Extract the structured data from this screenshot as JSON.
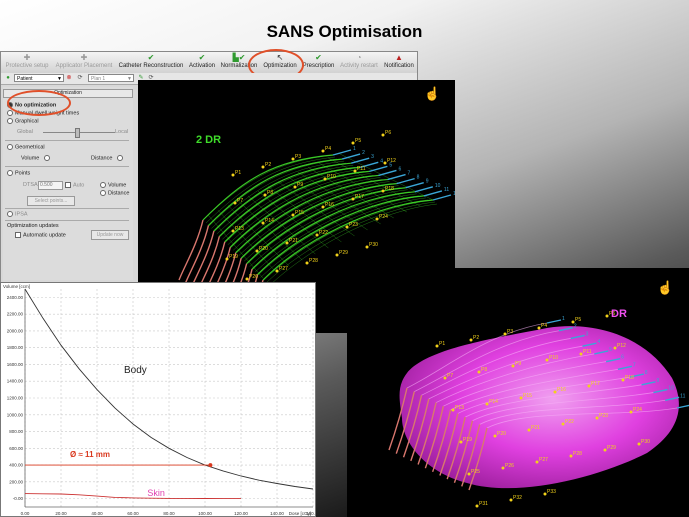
{
  "slide_title": "SANS Optimisation",
  "toolbar": {
    "buttons": [
      {
        "label": "Protective setup",
        "icon": "plus-icon",
        "state": "disabled"
      },
      {
        "label": "Applicator Placement",
        "icon": "plus-icon",
        "state": "disabled"
      },
      {
        "label": "Catheter Reconstruction",
        "icon": "check-icon",
        "state": "active"
      },
      {
        "label": "Activation",
        "icon": "check-icon",
        "state": "active"
      },
      {
        "label": "Normalization",
        "icon": "histogram-check-icon",
        "state": "active"
      },
      {
        "label": "Optimization",
        "icon": "arrow-cursor-icon",
        "state": "selected"
      },
      {
        "label": "Prescription",
        "icon": "check-icon",
        "state": "active"
      },
      {
        "label": "Activity restart",
        "icon": "clock-icon",
        "state": "disabled"
      },
      {
        "label": "Notification",
        "icon": "warning-icon",
        "state": "active"
      }
    ],
    "patient_select": "Patient",
    "plan_select": "Plan 1"
  },
  "optimization_panel": {
    "header": "Optimization",
    "options": {
      "no_optimization": "No optimization",
      "manual_dwell": "Manual dwell weight times",
      "graphical": "Graphical",
      "global": "Global",
      "local": "Local",
      "geometrical": "Geometrical",
      "volume": "Volume",
      "distance": "Distance",
      "points": "Points",
      "dtsa_label": "DTSA",
      "dtsa_value": "0.500",
      "auto": "Auto",
      "volume2": "Volume",
      "distance2": "Distance",
      "select_points": "Select points...",
      "ipsa": "IPSA",
      "updates_header": "Optimization updates",
      "automatic_update": "Automatic update",
      "update_now": "Update now"
    }
  },
  "view_2dr": {
    "label": "2 DR",
    "mesh_color": "#3fdc2a",
    "point_labels": [
      "P1",
      "P2",
      "P3",
      "P4",
      "P5",
      "P6",
      "P7",
      "P8",
      "P9",
      "P10",
      "P11",
      "P12",
      "P13",
      "P14",
      "P15",
      "P16",
      "P17",
      "P18",
      "P19",
      "P20",
      "P21",
      "P22",
      "P23",
      "P24",
      "P25",
      "P26",
      "P27",
      "P28",
      "P29",
      "P30",
      "P31",
      "P32",
      "P33"
    ],
    "catheter_numbers": [
      "1",
      "2",
      "3",
      "4",
      "5",
      "6",
      "7",
      "8",
      "9",
      "10",
      "11",
      "12",
      "13"
    ]
  },
  "view_dr": {
    "label": "DR",
    "volume_color": "#e83ce8",
    "point_labels": [
      "P1",
      "P2",
      "P3",
      "P4",
      "P5",
      "P6",
      "P7",
      "P8",
      "P9",
      "P10",
      "P11",
      "P12",
      "P13",
      "P14",
      "P15",
      "P16",
      "P17",
      "P18",
      "P19",
      "P20",
      "P21",
      "P22",
      "P23",
      "P24",
      "P25",
      "P26",
      "P27",
      "P28",
      "P29",
      "P30",
      "P31",
      "P32",
      "P33"
    ],
    "catheter_numbers": [
      "1",
      "2",
      "3",
      "4",
      "5",
      "6",
      "7",
      "8",
      "9",
      "10",
      "11",
      "12",
      "13"
    ]
  },
  "chart_data": {
    "type": "line",
    "ylabel": "Volume [ccm]",
    "xlabel": "Dose [cGy]",
    "xlim": [
      0,
      160
    ],
    "ylim": [
      -100,
      2500
    ],
    "xticks": [
      "0.00",
      "20.00",
      "40.00",
      "60.00",
      "80.00",
      "100.00",
      "120.00",
      "140.00",
      "160.00"
    ],
    "yticks": [
      "-0.00",
      "200.00",
      "400.00",
      "600.00",
      "800.00",
      "1000.00",
      "1200.00",
      "1400.00",
      "1600.00",
      "1800.00",
      "2000.00",
      "2200.00",
      "2400.00"
    ],
    "series": [
      {
        "name": "Body",
        "color": "#333333",
        "x": [
          0,
          10,
          20,
          30,
          40,
          50,
          60,
          70,
          80,
          90,
          100,
          110,
          120,
          130,
          140,
          150,
          160
        ],
        "y": [
          2500,
          2150,
          1830,
          1550,
          1300,
          1080,
          890,
          730,
          600,
          490,
          400,
          330,
          270,
          220,
          180,
          145,
          115
        ]
      },
      {
        "name": "Skin",
        "color": "#cc3333",
        "x": [
          0,
          10,
          20,
          30,
          40,
          50,
          60,
          70,
          80,
          90,
          100,
          110,
          120
        ],
        "y": [
          60,
          58,
          55,
          45,
          30,
          15,
          8,
          5,
          3,
          2,
          1,
          0,
          0
        ]
      }
    ],
    "annotations": {
      "body_label": "Body",
      "skin_label": "Skin",
      "marker_label": "Ø ≈ 11 mm",
      "marker_x": 103,
      "marker_y": 400
    }
  }
}
